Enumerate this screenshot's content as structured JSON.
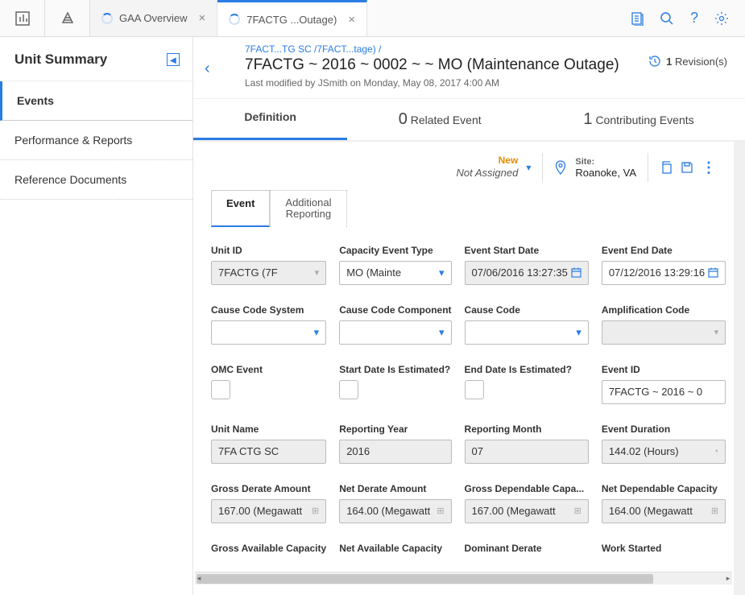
{
  "topbar": {
    "tabs": [
      {
        "label": "GAA Overview",
        "active": false
      },
      {
        "label": "7FACTG ...Outage)",
        "active": true
      }
    ]
  },
  "topbar_icons": [
    "clipboard-icon",
    "magnify-icon",
    "help-icon",
    "gear-icon"
  ],
  "sidebar": {
    "title": "Unit Summary",
    "items": [
      {
        "label": "Events",
        "active": true
      },
      {
        "label": "Performance & Reports",
        "active": false
      },
      {
        "label": "Reference Documents",
        "active": false
      }
    ]
  },
  "header": {
    "breadcrumb": "7FACT...TG SC /7FACT...tage) /",
    "title": "7FACTG ~ 2016 ~ 0002 ~ ~ MO (Maintenance Outage)",
    "subtitle": "Last modified by JSmith on Monday, May 08, 2017 4:00 AM",
    "revisions_count": "1",
    "revisions_label": "Revision(s)"
  },
  "tabs": {
    "definition": "Definition",
    "related_count": "0",
    "related_label": "Related Event",
    "contrib_count": "1",
    "contrib_label": "Contributing Events"
  },
  "meta": {
    "new_label": "New",
    "assigned": "Not Assigned",
    "site_label": "Site:",
    "site_value": "Roanoke, VA"
  },
  "subtabs": {
    "event": "Event",
    "additional_l1": "Additional",
    "additional_l2": "Reporting"
  },
  "form": {
    "unit_id": {
      "label": "Unit ID",
      "value": "7FACTG (7F"
    },
    "capacity_event_type": {
      "label": "Capacity Event Type",
      "value": "MO (Mainte"
    },
    "event_start": {
      "label": "Event Start Date",
      "value": "07/06/2016 13:27:35"
    },
    "event_end": {
      "label": "Event End Date",
      "value": "07/12/2016 13:29:16"
    },
    "cause_code_system": {
      "label": "Cause Code System",
      "value": ""
    },
    "cause_code_component": {
      "label": "Cause Code Component",
      "value": ""
    },
    "cause_code": {
      "label": "Cause Code",
      "value": ""
    },
    "amplification_code": {
      "label": "Amplification Code",
      "value": ""
    },
    "omc_event": {
      "label": "OMC Event"
    },
    "start_est": {
      "label": "Start Date Is Estimated?"
    },
    "end_est": {
      "label": "End Date Is Estimated?"
    },
    "event_id": {
      "label": "Event ID",
      "value": "7FACTG ~ 2016 ~ 0"
    },
    "unit_name": {
      "label": "Unit Name",
      "value": "7FA CTG SC"
    },
    "reporting_year": {
      "label": "Reporting Year",
      "value": "2016"
    },
    "reporting_month": {
      "label": "Reporting Month",
      "value": "07"
    },
    "event_duration": {
      "label": "Event Duration",
      "value": "144.02 (Hours)"
    },
    "gross_derate": {
      "label": "Gross Derate Amount",
      "value": "167.00 (Megawatt"
    },
    "net_derate": {
      "label": "Net Derate Amount",
      "value": "164.00 (Megawatt"
    },
    "gross_dep_cap": {
      "label": "Gross Dependable Capa...",
      "value": "167.00 (Megawatt"
    },
    "net_dep_cap": {
      "label": "Net Dependable Capacity",
      "value": "164.00 (Megawatt"
    },
    "gross_avail_cap": {
      "label": "Gross Available Capacity"
    },
    "net_avail_cap": {
      "label": "Net Available Capacity"
    },
    "dominant_derate": {
      "label": "Dominant Derate"
    },
    "work_started": {
      "label": "Work Started"
    }
  }
}
